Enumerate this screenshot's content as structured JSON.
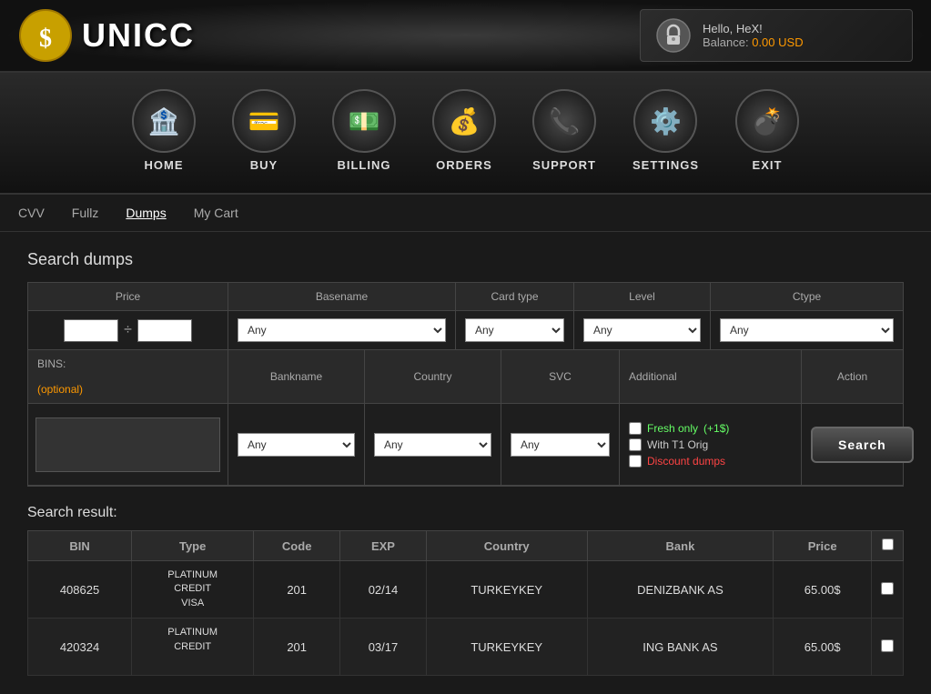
{
  "header": {
    "logo_text": "UNICC",
    "hello_text": "Hello, HeX!",
    "balance_label": "Balance:",
    "balance_value": "0.00 USD"
  },
  "nav": {
    "items": [
      {
        "label": "HOME",
        "icon": "🏦"
      },
      {
        "label": "BUY",
        "icon": "💳"
      },
      {
        "label": "BILLING",
        "icon": "💵"
      },
      {
        "label": "ORDERS",
        "icon": "💰"
      },
      {
        "label": "SUPPORT",
        "icon": "📞"
      },
      {
        "label": "SETTINGS",
        "icon": "⚙️"
      },
      {
        "label": "EXIT",
        "icon": "💣"
      }
    ]
  },
  "subnav": {
    "items": [
      {
        "label": "CVV",
        "active": false
      },
      {
        "label": "Fullz",
        "active": false
      },
      {
        "label": "Dumps",
        "active": true
      },
      {
        "label": "My Cart",
        "active": false
      }
    ]
  },
  "search": {
    "title": "Search dumps",
    "price_label": "Price",
    "basename_label": "Basename",
    "cardtype_label": "Card type",
    "level_label": "Level",
    "ctype_label": "Ctype",
    "bins_label": "BINS:",
    "bins_hint": "(optional)",
    "bankname_label": "Bankname",
    "country_label": "Country",
    "svc_label": "SVC",
    "additional_label": "Additional",
    "action_label": "Action",
    "any_option": "Any",
    "fresh_only_label": "Fresh only",
    "fresh_bonus": "(+1$)",
    "with_t1_label": "With T1 Orig",
    "discount_label": "Discount dumps",
    "search_button": "Search"
  },
  "results": {
    "title": "Search result:",
    "columns": [
      "BIN",
      "Type",
      "Code",
      "EXP",
      "Country",
      "Bank",
      "Price",
      ""
    ],
    "rows": [
      {
        "bin": "408625",
        "type_line1": "PLATINUM",
        "type_line2": "CREDIT",
        "type_line3": "VISA",
        "code": "201",
        "exp": "02/14",
        "country": "TURKEYKEY",
        "bank": "DENIZBANK AS",
        "price": "65.00$"
      },
      {
        "bin": "420324",
        "type_line1": "PLATINUM",
        "type_line2": "CREDIT",
        "type_line3": "",
        "code": "201",
        "exp": "03/17",
        "country": "TURKEYKEY",
        "bank": "ING BANK AS",
        "price": "65.00$"
      }
    ]
  }
}
